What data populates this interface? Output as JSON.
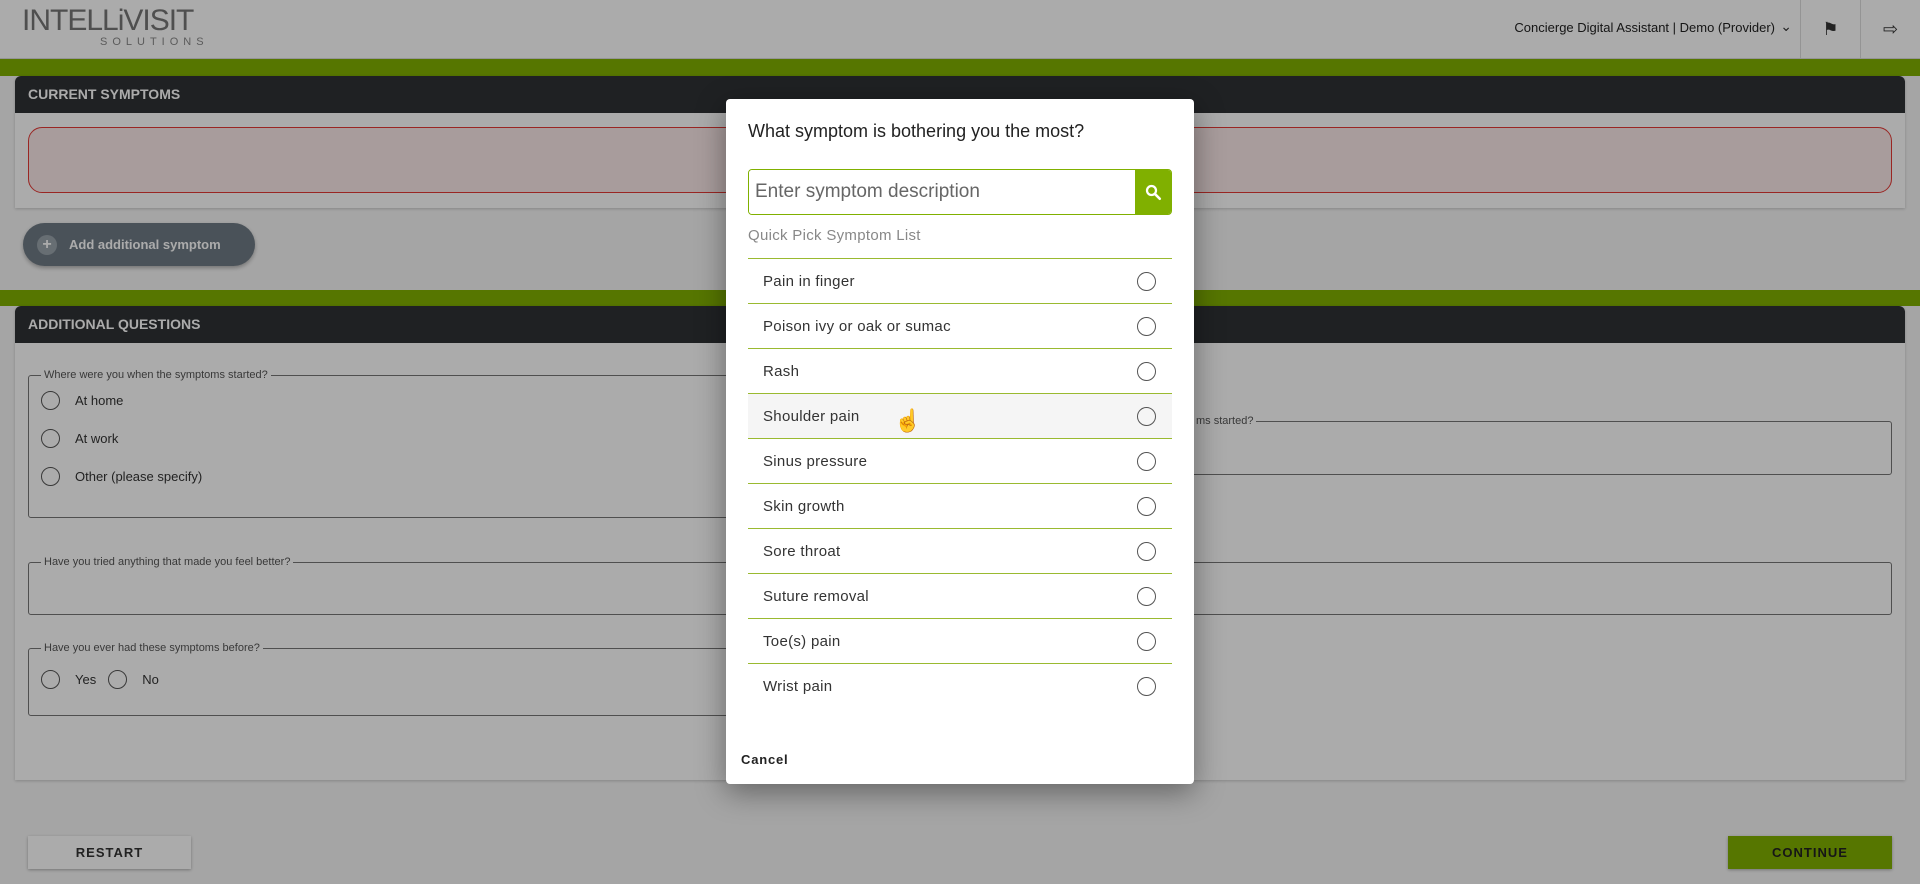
{
  "header": {
    "logo_main": "INTELLiVISIT",
    "logo_sub": "SOLUTIONS",
    "account": "Concierge Digital Assistant | Demo (Provider)"
  },
  "current_symptoms": {
    "title": "CURRENT SYMPTOMS",
    "add_label": "Add additional symptom"
  },
  "additional_questions": {
    "title": "ADDITIONAL QUESTIONS",
    "where_started": {
      "legend": "Where were you when the symptoms started?",
      "options": [
        "At home",
        "At work",
        "Other (please specify)"
      ]
    },
    "right_field_legend": "ms started?",
    "tried": {
      "legend": "Have you tried anything that made you feel better?"
    },
    "before": {
      "legend": "Have you ever had these symptoms before?",
      "options": [
        "Yes",
        "No"
      ]
    }
  },
  "footer": {
    "restart": "RESTART",
    "continue": "CONTINUE"
  },
  "dialog": {
    "title": "What symptom is bothering you the most?",
    "search_placeholder": "Enter symptom description",
    "quick_pick_label": "Quick Pick Symptom List",
    "items": [
      "Pain in finger",
      "Poison ivy or oak or sumac",
      "Rash",
      "Shoulder pain",
      "Sinus pressure",
      "Skin growth",
      "Sore throat",
      "Suture removal",
      "Toe(s) pain",
      "Wrist pain"
    ],
    "cancel": "Cancel"
  },
  "colors": {
    "accent": "#80b000",
    "header_dark": "#2f3235",
    "error": "#e53935"
  }
}
